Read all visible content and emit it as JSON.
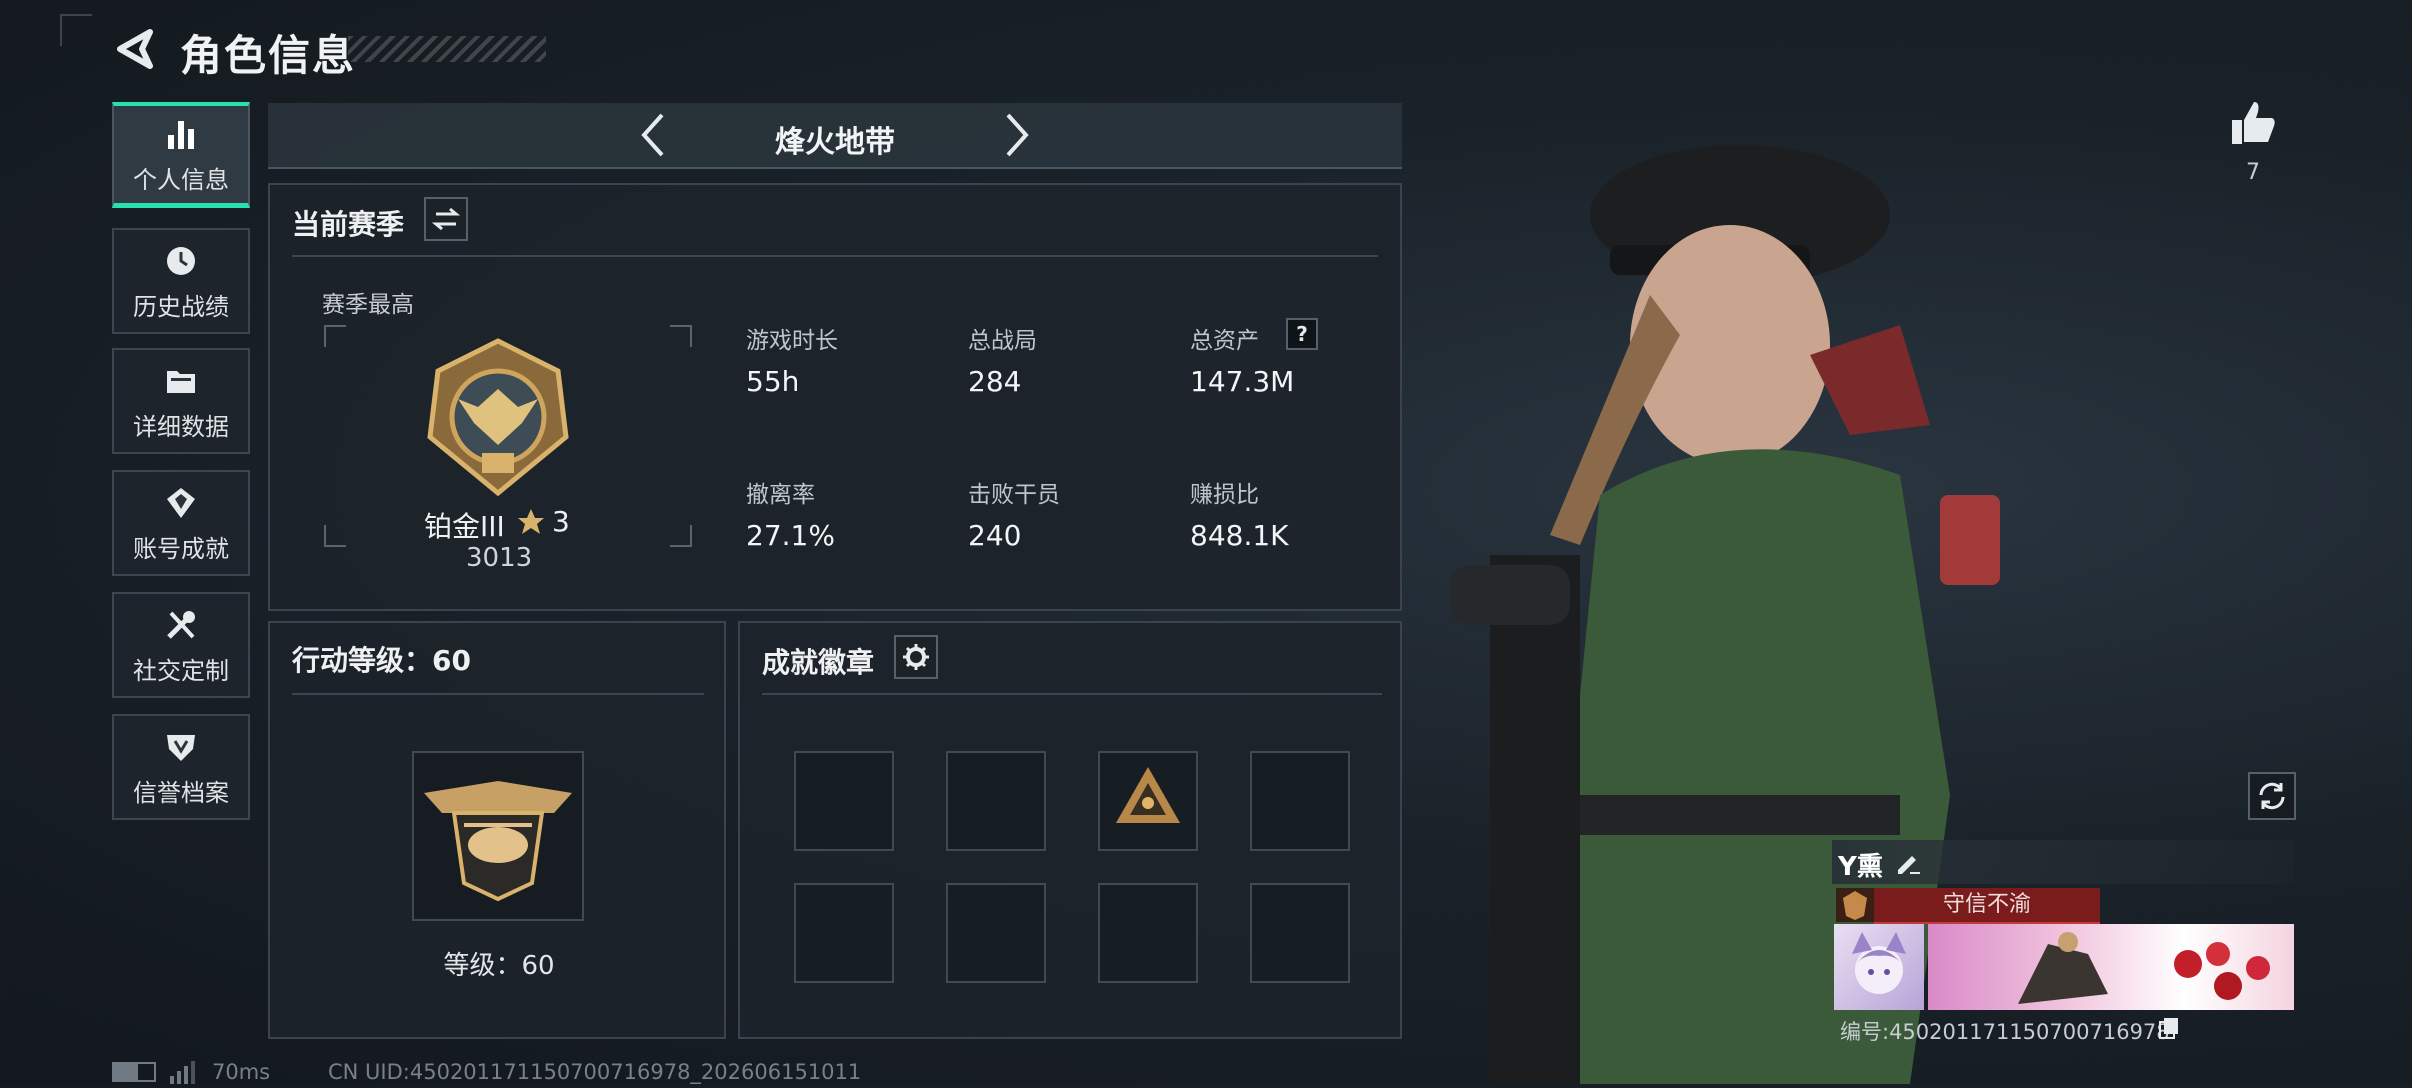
{
  "header": {
    "title": "角色信息"
  },
  "sidebar": {
    "items": [
      {
        "label": "个人信息",
        "icon": "bar-chart-icon",
        "active": true
      },
      {
        "label": "历史战绩",
        "icon": "history-icon",
        "active": false
      },
      {
        "label": "详细数据",
        "icon": "folder-icon",
        "active": false
      },
      {
        "label": "账号成就",
        "icon": "achievement-icon",
        "active": false
      },
      {
        "label": "社交定制",
        "icon": "tools-icon",
        "active": false
      },
      {
        "label": "信誉档案",
        "icon": "reputation-icon",
        "active": false
      }
    ]
  },
  "mode": {
    "label": "烽火地带"
  },
  "season": {
    "title": "当前赛季",
    "best_label": "赛季最高",
    "rank_name": "铂金III",
    "rank_stars": "3",
    "rank_score": "3013",
    "stats": [
      {
        "label": "游戏时长",
        "value": "55h"
      },
      {
        "label": "总战局",
        "value": "284"
      },
      {
        "label": "总资产",
        "value": "147.3M",
        "help": "?"
      },
      {
        "label": "撤离率",
        "value": "27.1%"
      },
      {
        "label": "击败干员",
        "value": "240"
      },
      {
        "label": "赚损比",
        "value": "848.1K"
      }
    ]
  },
  "level": {
    "title": "行动等级：60",
    "caption": "等级：60"
  },
  "badges": {
    "title": "成就徽章"
  },
  "likes": {
    "count": "7"
  },
  "profile": {
    "name": "Y熏",
    "title_badge": "守信不渝",
    "id_text": "编号:450201171150700716978"
  },
  "status": {
    "ping": "70ms",
    "uid": "CN UID:450201171150700716978_202606151011"
  },
  "colors": {
    "accent": "#27e2b0",
    "title_badge_bg": "#7a1c1c"
  }
}
